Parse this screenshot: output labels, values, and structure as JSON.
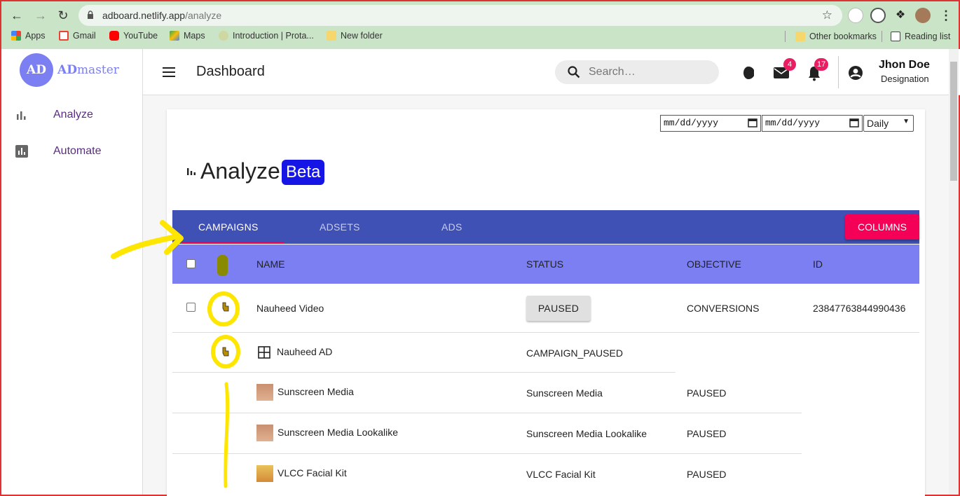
{
  "browser": {
    "url_host": "adboard.netlify.app",
    "url_path": "/analyze",
    "bookmarks": [
      "Apps",
      "Gmail",
      "YouTube",
      "Maps",
      "Introduction | Prota...",
      "New folder"
    ],
    "other_bookmarks": "Other bookmarks",
    "reading_list": "Reading list"
  },
  "app": {
    "logo_badge": "AD",
    "logo_text_bold": "AD",
    "logo_text_rest": "master",
    "sidebar": [
      {
        "label": "Analyze",
        "icon": "bar-chart-icon"
      },
      {
        "label": "Automate",
        "icon": "assessment-icon"
      }
    ],
    "topbar": {
      "title": "Dashboard",
      "search_placeholder": "Search…",
      "mail_count": "4",
      "notification_count": "17",
      "user_name": "Jhon Doe",
      "user_designation": "Designation"
    }
  },
  "analyze": {
    "date_from_placeholder": "mm/dd/yyyy",
    "date_to_placeholder": "mm/dd/yyyy",
    "granularity": "Daily",
    "title": "Analyze",
    "badge": "Beta",
    "tabs": [
      "CAMPAIGNS",
      "ADSETS",
      "ADS"
    ],
    "active_tab": "CAMPAIGNS",
    "columns_button": "COLUMNS",
    "table_headers": [
      "NAME",
      "STATUS",
      "OBJECTIVE",
      "ID"
    ],
    "campaign": {
      "name": "Nauheed Video",
      "status": "PAUSED",
      "objective": "CONVERSIONS",
      "id": "23847763844990436"
    },
    "adset": {
      "name": "Nauheed AD",
      "status": "CAMPAIGN_PAUSED"
    },
    "ads": [
      {
        "name": "Sunscreen Media",
        "adset": "Sunscreen Media",
        "status": "PAUSED"
      },
      {
        "name": "Sunscreen Media Lookalike",
        "adset": "Sunscreen Media Lookalike",
        "status": "PAUSED"
      },
      {
        "name": "VLCC Facial Kit",
        "adset": "VLCC Facial Kit",
        "status": "PAUSED"
      }
    ]
  },
  "colors": {
    "primary": "#3f51b5",
    "header_row": "#7b7ff1",
    "accent": "#f50057",
    "beta": "#1515e6",
    "highlight": "#ffe600",
    "frame": "#dd3333"
  }
}
